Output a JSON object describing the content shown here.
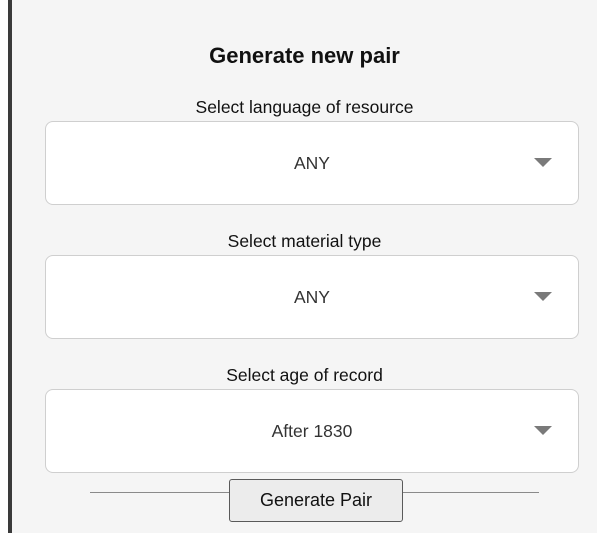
{
  "panel": {
    "title": "Generate new pair"
  },
  "fields": [
    {
      "label": "Select language of resource",
      "value": "ANY",
      "icon": "chevron-down-icon"
    },
    {
      "label": "Select material type",
      "value": "ANY",
      "icon": "chevron-down-icon"
    },
    {
      "label": "Select age of record",
      "value": "After 1830",
      "icon": "chevron-down-icon"
    }
  ],
  "actions": {
    "generate_label": "Generate Pair"
  },
  "colors": {
    "panel_background": "#f5f5f5",
    "left_border": "#3a3a3a",
    "select_border": "#cfcfcf",
    "chevron": "#7a7a7a",
    "button_background": "#ececec"
  }
}
